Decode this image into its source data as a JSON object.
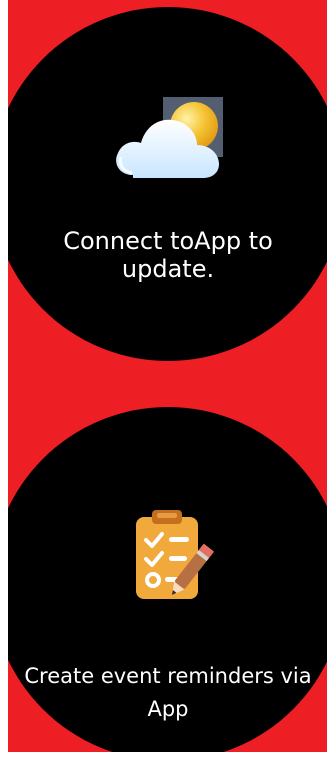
{
  "colors": {
    "background_accent": "#ee1e25",
    "watch_face": "#000000",
    "text": "#ffffff",
    "cloud": "#dff3ff",
    "sun": "#f2b81b",
    "clipboard": "#f2a93b"
  },
  "screens": [
    {
      "icon": "weather-cloud-sun-icon",
      "message": "Connect toApp to update."
    },
    {
      "icon": "clipboard-checklist-pencil-icon",
      "message": "Create event reminders via App"
    }
  ]
}
